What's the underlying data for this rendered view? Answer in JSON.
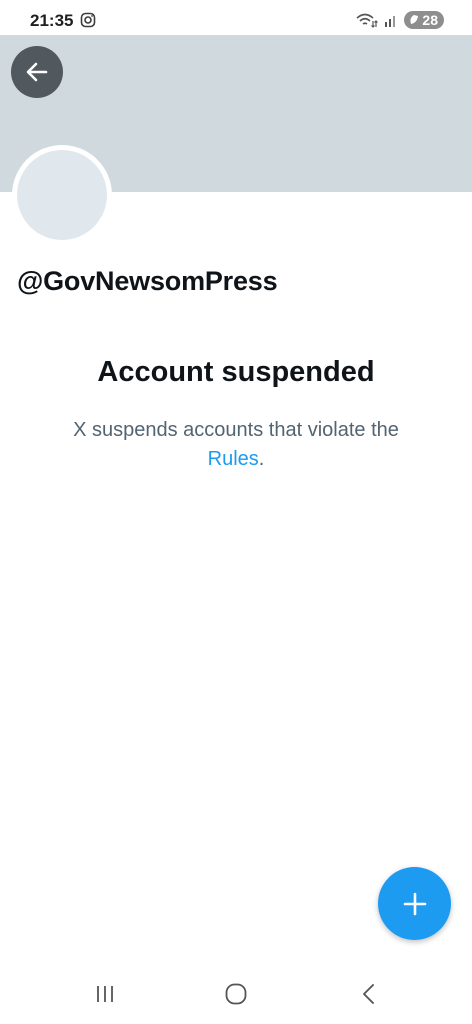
{
  "status_bar": {
    "time": "21:35",
    "battery": "28",
    "icons": [
      "instagram-icon",
      "wifi-icon",
      "signal-icon",
      "battery-icon"
    ]
  },
  "profile": {
    "handle": "@GovNewsomPress"
  },
  "suspension": {
    "title": "Account suspended",
    "message": "X suspends accounts that violate the",
    "link_text": "Rules",
    "period": "."
  },
  "colors": {
    "banner": "#cfd9de",
    "accent": "#1d9bf0",
    "muted_text": "#536471"
  },
  "fab": {
    "icon": "plus-icon"
  },
  "nav": {
    "icons": [
      "recents-icon",
      "home-icon",
      "back-icon"
    ]
  }
}
